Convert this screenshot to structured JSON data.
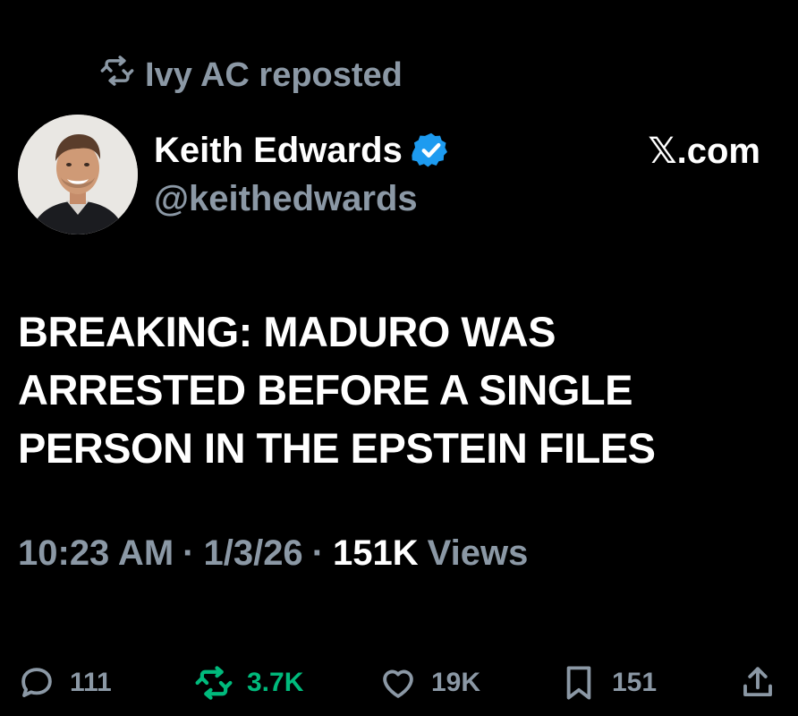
{
  "repost": {
    "icon": "repost-icon",
    "text": "Ivy AC reposted"
  },
  "author": {
    "display_name": "Keith Edwards",
    "handle": "@keithedwards",
    "verified_icon": "verified-badge-icon",
    "verified_color": "#1d9bf0",
    "avatar": "avatar-photo"
  },
  "source": "𝕏.com",
  "tweet": {
    "lines": [
      "BREAKING: MADURO WAS",
      "ARRESTED BEFORE A SINGLE",
      "PERSON IN THE EPSTEIN FILES"
    ]
  },
  "meta": {
    "time": "10:23 AM",
    "separator": "·",
    "date": "1/3/26",
    "views_count": "151K",
    "views_label": "Views"
  },
  "actions": {
    "reply": {
      "icon": "reply-icon",
      "count": "111"
    },
    "repost": {
      "icon": "repost-icon",
      "count": "3.7K",
      "color": "#00ba7c"
    },
    "like": {
      "icon": "heart-icon",
      "count": "19K"
    },
    "bookmark": {
      "icon": "bookmark-icon",
      "count": "151"
    },
    "share": {
      "icon": "share-icon"
    }
  },
  "colors": {
    "background": "#000000",
    "primary_text": "#ffffff",
    "secondary_text": "#8b98a5"
  }
}
